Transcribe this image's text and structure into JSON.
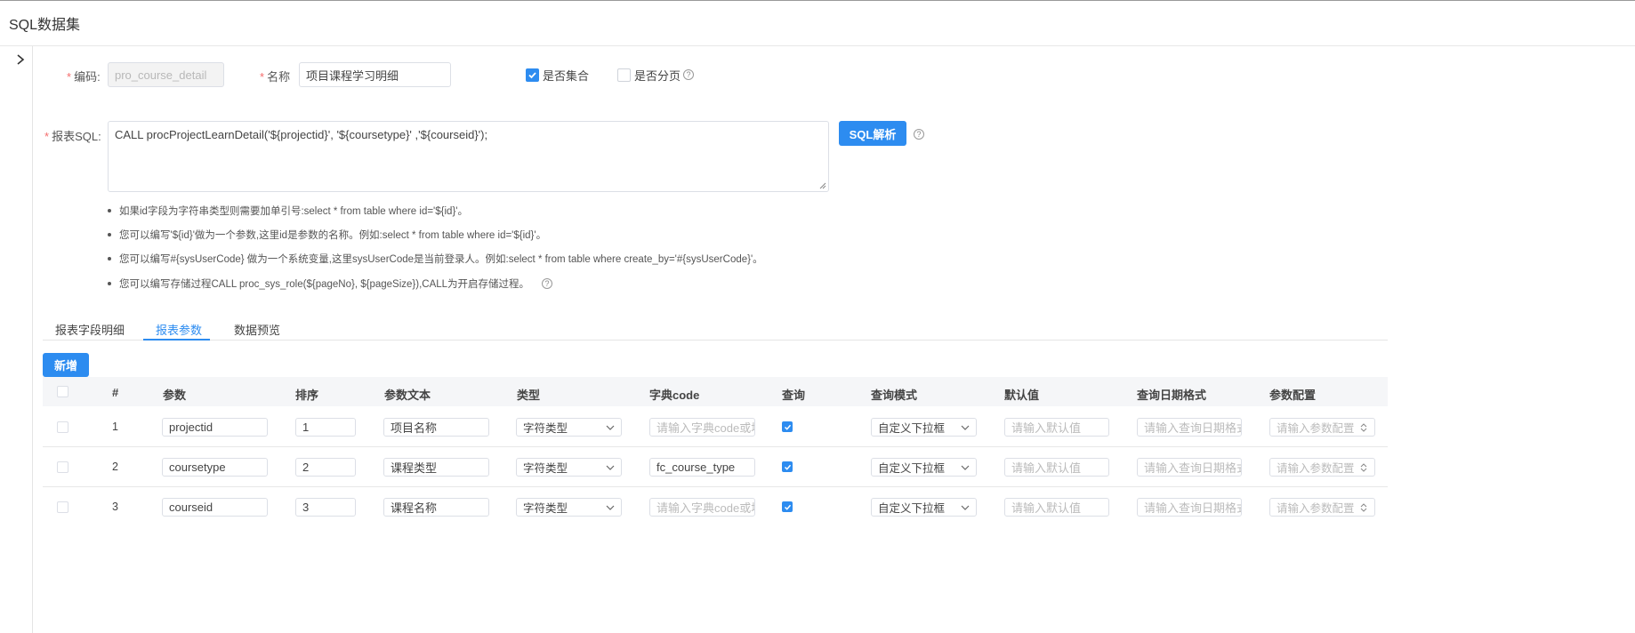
{
  "page": {
    "title": "SQL数据集"
  },
  "form": {
    "code_label": "编码:",
    "code_value": "pro_course_detail",
    "name_label": "名称",
    "name_value": "项目课程学习明细",
    "is_collection_label": "是否集合",
    "is_collection_checked": true,
    "is_paged_label": "是否分页",
    "is_paged_checked": false,
    "sql_label": "报表SQL:",
    "sql_value": "CALL procProjectLearnDetail('${projectid}', '${coursetype}' ,'${courseid}');",
    "parse_button": "SQL解析",
    "required_mark": "*"
  },
  "tips": [
    "如果id字段为字符串类型则需要加单引号:select * from table where id='${id}'。",
    "您可以编写'${id}'做为一个参数,这里id是参数的名称。例如:select * from table where id='${id}'。",
    "您可以编写#{sysUserCode} 做为一个系统变量,这里sysUserCode是当前登录人。例如:select * from table where create_by='#{sysUserCode}'。",
    "您可以编写存储过程CALL proc_sys_role(${pageNo}, ${pageSize}),CALL为开启存储过程。"
  ],
  "tabs": [
    {
      "label": "报表字段明细",
      "active": false
    },
    {
      "label": "报表参数",
      "active": true
    },
    {
      "label": "数据预览",
      "active": false
    }
  ],
  "add_button": "新增",
  "table": {
    "columns": [
      "#",
      "参数",
      "排序",
      "参数文本",
      "类型",
      "字典code",
      "查询",
      "查询模式",
      "默认值",
      "查询日期格式",
      "参数配置"
    ],
    "placeholders": {
      "dict_code": "请输入字典code或地",
      "default_value": "请输入默认值",
      "date_format": "请输入查询日期格式",
      "param_config": "请输入参数配置"
    },
    "rows": [
      {
        "index": "1",
        "param": "projectid",
        "order": "1",
        "text": "项目名称",
        "type": "字符类型",
        "dict_code": "",
        "query": true,
        "mode": "自定义下拉框"
      },
      {
        "index": "2",
        "param": "coursetype",
        "order": "2",
        "text": "课程类型",
        "type": "字符类型",
        "dict_code": "fc_course_type",
        "query": true,
        "mode": "自定义下拉框"
      },
      {
        "index": "3",
        "param": "courseid",
        "order": "3",
        "text": "课程名称",
        "type": "字符类型",
        "dict_code": "",
        "query": true,
        "mode": "自定义下拉框"
      }
    ]
  },
  "colors": {
    "primary": "#2d8cf0",
    "required": "#f56c6c"
  }
}
